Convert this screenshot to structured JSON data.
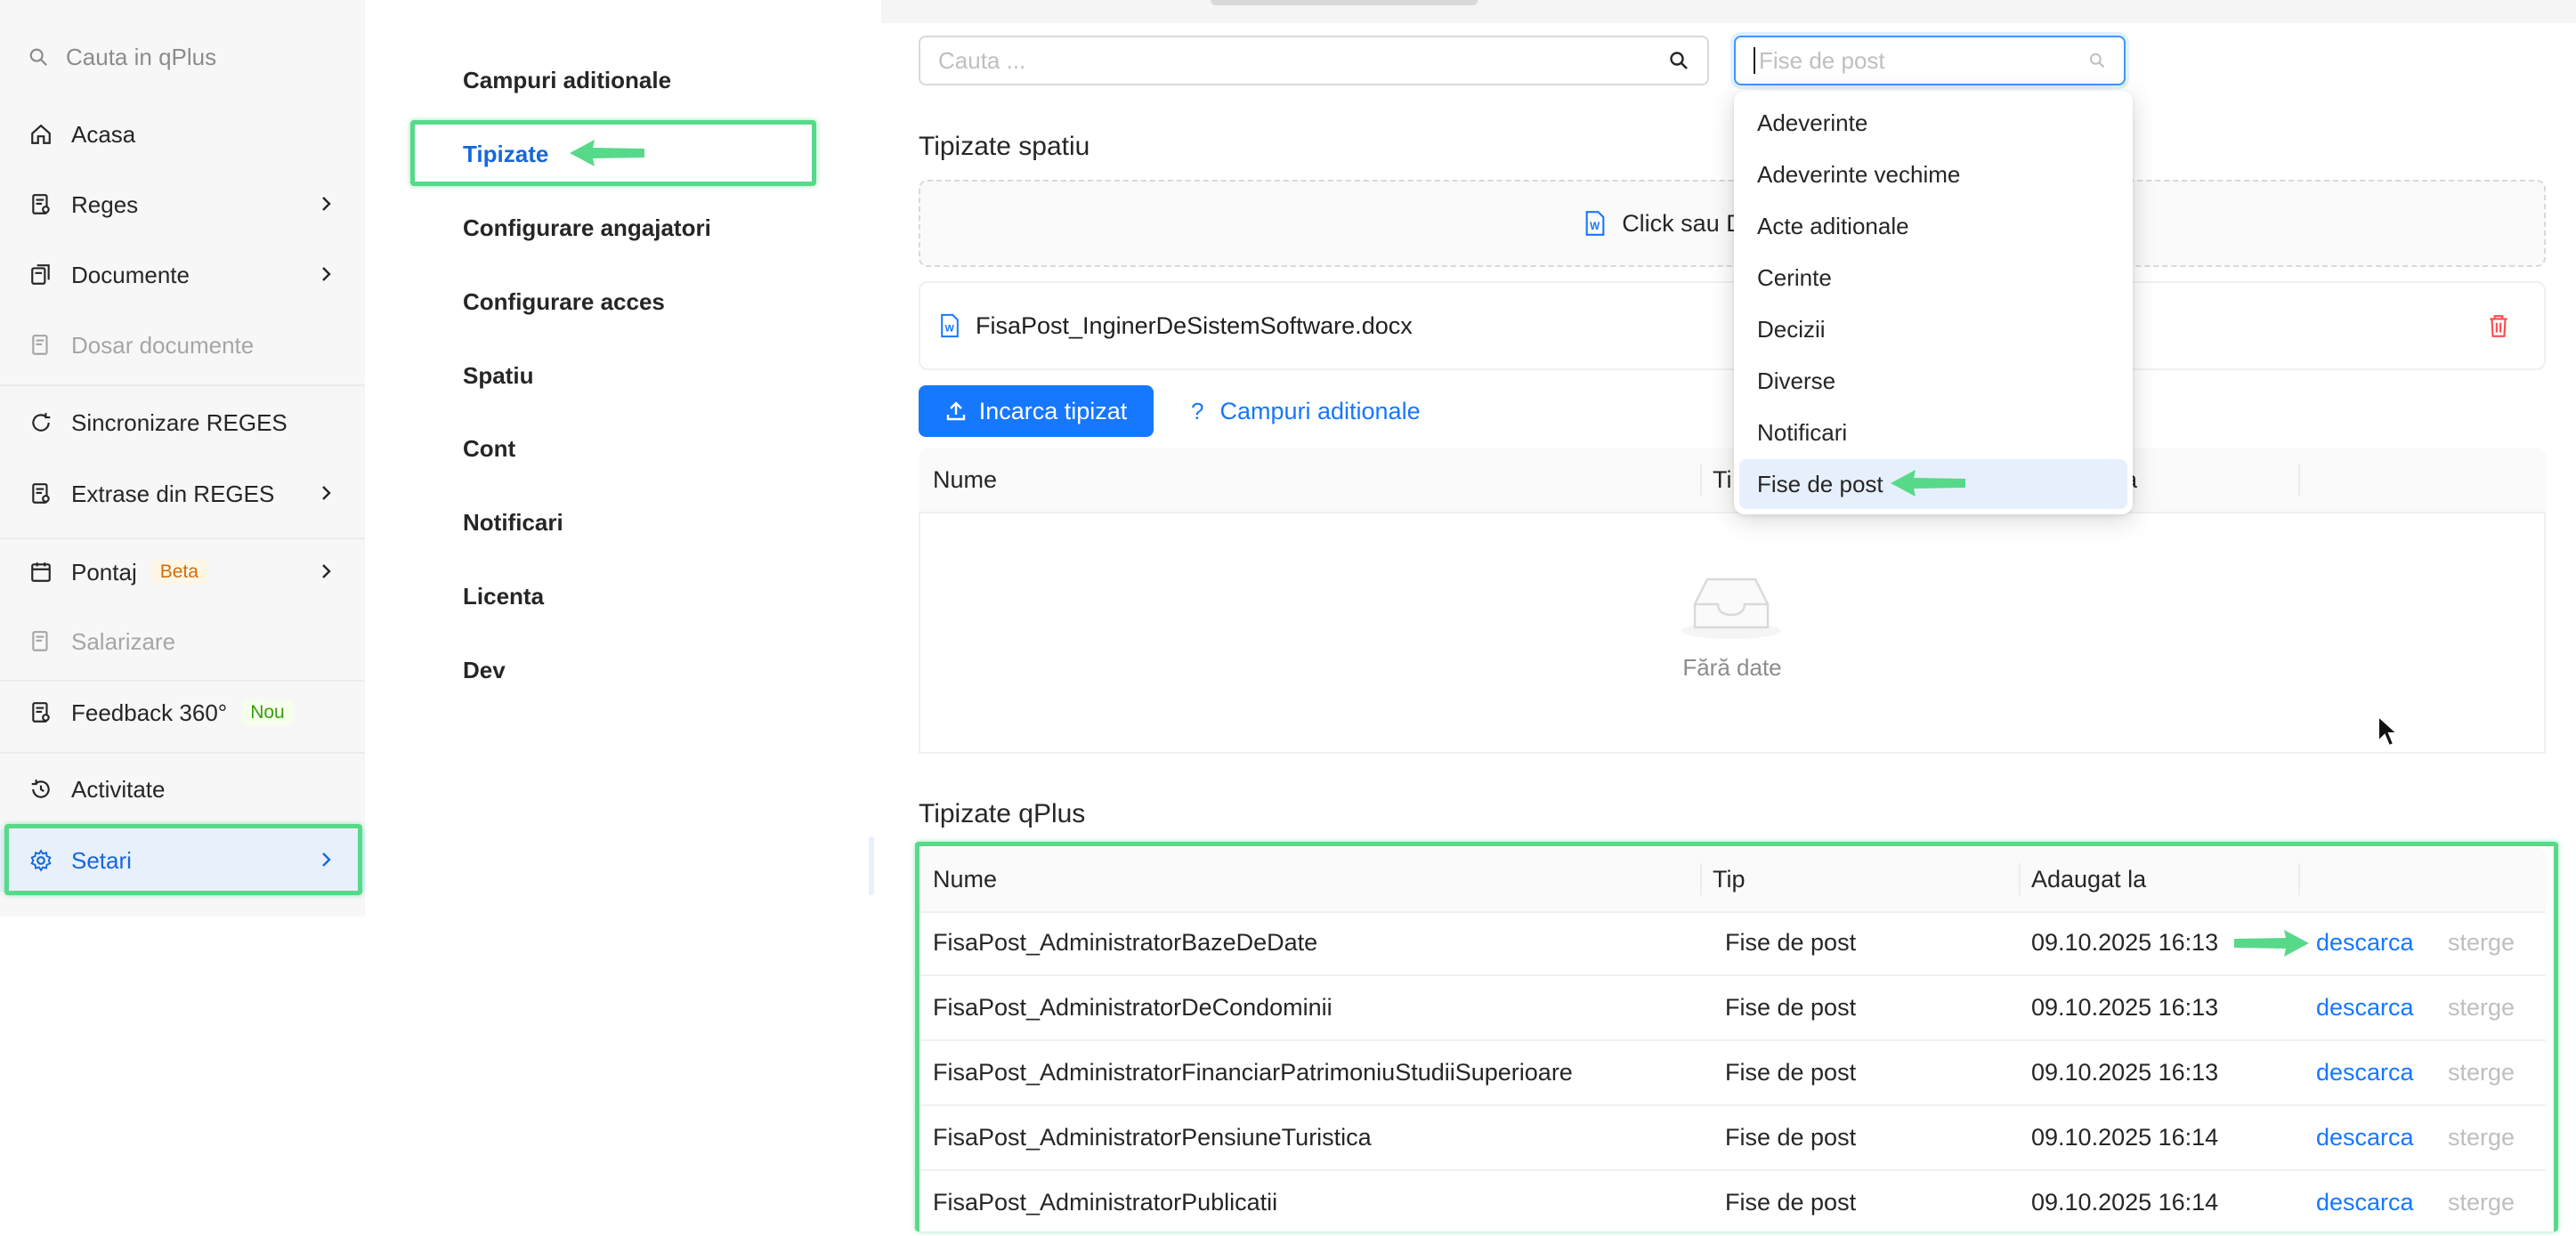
{
  "sidebar": {
    "search_placeholder": "Cauta in qPlus",
    "items": [
      {
        "label": "Acasa"
      },
      {
        "label": "Reges"
      },
      {
        "label": "Documente"
      },
      {
        "label": "Dosar documente"
      },
      {
        "label": "Sincronizare REGES"
      },
      {
        "label": "Extrase din REGES"
      },
      {
        "label": "Pontaj",
        "badge": "Beta"
      },
      {
        "label": "Salarizare"
      },
      {
        "label": "Feedback 360°",
        "badge": "Nou"
      },
      {
        "label": "Activitate"
      },
      {
        "label": "Setari"
      }
    ]
  },
  "submenu": {
    "items": [
      {
        "label": "Campuri aditionale"
      },
      {
        "label": "Tipizate"
      },
      {
        "label": "Configurare angajatori"
      },
      {
        "label": "Configurare acces"
      },
      {
        "label": "Spatiu"
      },
      {
        "label": "Cont"
      },
      {
        "label": "Notificari"
      },
      {
        "label": "Licenta"
      },
      {
        "label": "Dev"
      }
    ]
  },
  "main": {
    "search_placeholder": "Cauta ...",
    "type_filter_placeholder": "Fise de post",
    "dropdown_options": [
      "Adeverinte",
      "Adeverinte vechime",
      "Acte aditionale",
      "Cerinte",
      "Decizii",
      "Diverse",
      "Notificari",
      "Fise de post"
    ],
    "tipizate_spatiu": {
      "title": "Tipizate spatiu",
      "dropzone_text": "Click sau Drag & Drop p",
      "uploaded_file": "FisaPost_InginerDeSistemSoftware.docx",
      "upload_button": "Incarca tipizat",
      "fields_link": "Campuri aditionale",
      "col_nume": "Nume",
      "col_tip_partial": "Ti",
      "col_adaugat_partial": "a",
      "empty_text": "Fără date"
    },
    "tipizate_qplus": {
      "title": "Tipizate qPlus",
      "columns": [
        "Nume",
        "Tip",
        "Adaugat la"
      ],
      "download_label": "descarca",
      "delete_label": "sterge",
      "rows": [
        {
          "name": "FisaPost_AdministratorBazeDeDate",
          "type": "Fise de post",
          "added": "09.10.2025 16:13"
        },
        {
          "name": "FisaPost_AdministratorDeCondominii",
          "type": "Fise de post",
          "added": "09.10.2025 16:13"
        },
        {
          "name": "FisaPost_AdministratorFinanciarPatrimoniuStudiiSuperioare",
          "type": "Fise de post",
          "added": "09.10.2025 16:13"
        },
        {
          "name": "FisaPost_AdministratorPensiuneTuristica",
          "type": "Fise de post",
          "added": "09.10.2025 16:14"
        },
        {
          "name": "FisaPost_AdministratorPublicatii",
          "type": "Fise de post",
          "added": "09.10.2025 16:14"
        }
      ]
    }
  },
  "colors": {
    "accent": "#1677ff",
    "highlight": "#57d98a",
    "danger": "#ff4d4f"
  }
}
